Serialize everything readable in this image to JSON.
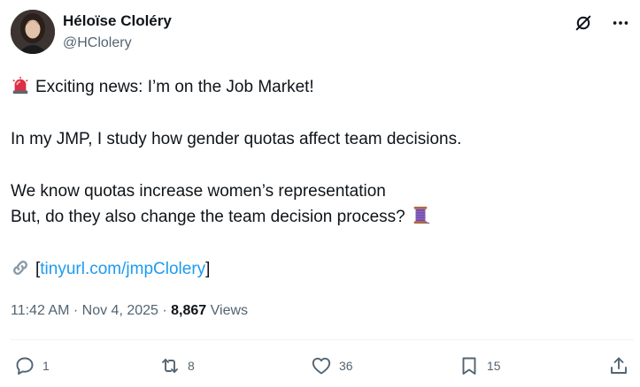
{
  "author": {
    "display_name": "Héloïse Cloléry",
    "handle": "@HClolery"
  },
  "tweet": {
    "line1": "Exciting news: I’m on the Job Market!",
    "line2": "In my JMP, I study how gender quotas affect team decisions.",
    "line3": "We know quotas increase women’s representation",
    "line4": "But, do they also change the team decision process?",
    "link_open": "[",
    "link_text": "tinyurl.com/jmpClolery",
    "link_close": "]"
  },
  "meta": {
    "time": "11:42 AM",
    "sep1": " · ",
    "date": "Nov 4, 2025",
    "sep2": " · ",
    "views_count": "8,867",
    "views_label": " Views"
  },
  "actions": {
    "replies": "1",
    "reposts": "8",
    "likes": "36",
    "bookmarks": "15"
  },
  "icons": {
    "header": [
      "grok-icon",
      "more-icon"
    ],
    "tweet": [
      "rotating-light-emoji",
      "thread-spool-emoji",
      "link-emoji"
    ],
    "actions": [
      "reply-icon",
      "repost-icon",
      "like-icon",
      "bookmark-icon",
      "share-icon"
    ]
  },
  "colors": {
    "text": "#0f1419",
    "secondary": "#536471",
    "link": "#1d9bf0",
    "divider": "#eff3f4"
  }
}
